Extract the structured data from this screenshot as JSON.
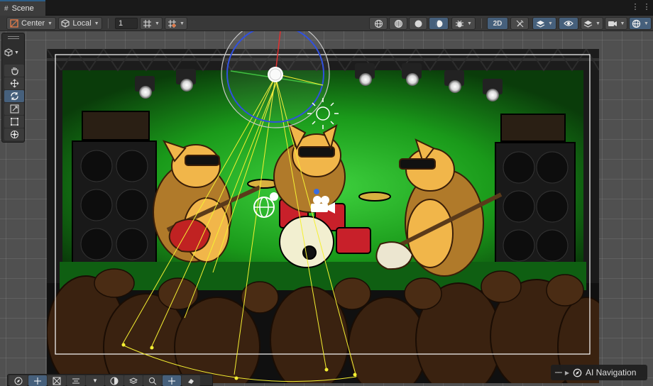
{
  "tab": {
    "title": "Scene"
  },
  "toolbar": {
    "pivot_label": "Center",
    "space_label": "Local",
    "increment_value": "1",
    "mode_2d_label": "2D"
  },
  "ai_navigation": {
    "label": "AI Navigation"
  },
  "colors": {
    "accent": "#46607c",
    "viewport_bg": "#505050",
    "stage_green": "#1f8a1f",
    "gizmo_yellow": "#f5f032",
    "camera_frame": "#ffffff"
  },
  "icons": {
    "tab": "scene-grid-icon",
    "pivot": "pivot-icon",
    "space": "local-space-cube-icon",
    "snap": "grid-snap-icon",
    "tools": [
      "hand-tool-icon",
      "move-tool-icon",
      "rotate-tool-icon",
      "scale-tool-icon",
      "rect-tool-icon",
      "transform-tool-icon"
    ],
    "scene_gizmos": [
      "light-gizmo-icon",
      "camera-gizmo-icon",
      "sun-gizmo-icon"
    ]
  }
}
